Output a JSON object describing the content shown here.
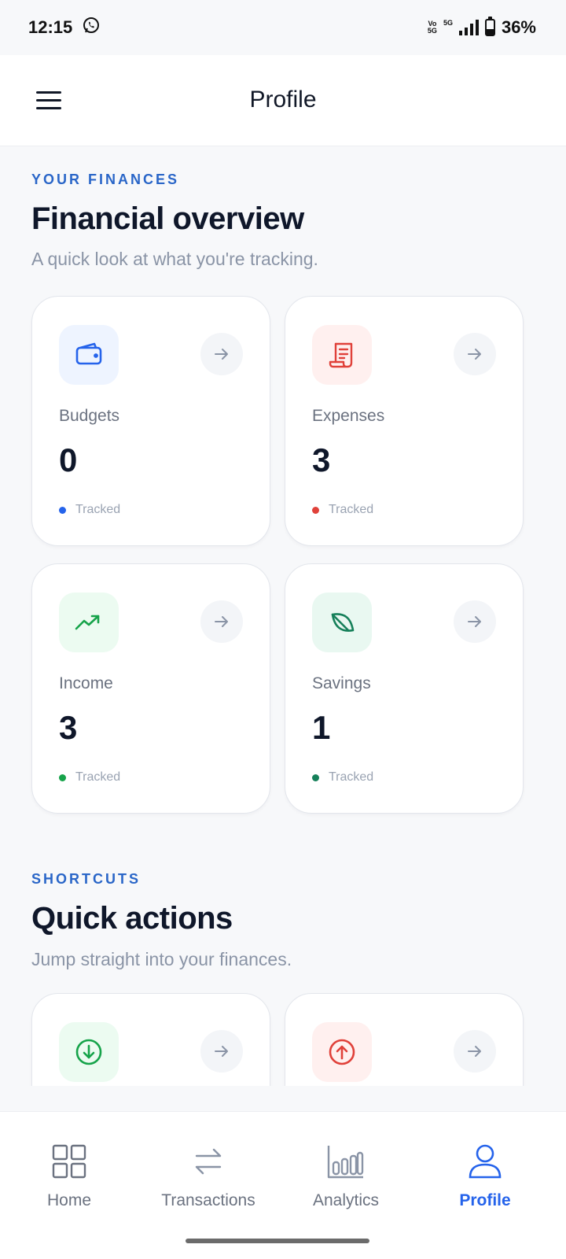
{
  "status_bar": {
    "time": "12:15",
    "whatsapp_icon": "whatsapp-icon",
    "volte_top": "Vo",
    "volte_bottom": "5G",
    "network": "5G",
    "battery": "36%"
  },
  "header": {
    "title": "Profile",
    "menu_icon": "hamburger-menu-icon"
  },
  "finances": {
    "eyebrow": "YOUR FINANCES",
    "title": "Financial overview",
    "subtitle": "A quick look at what you're tracking.",
    "cards": [
      {
        "label": "Budgets",
        "value": "0",
        "status": "Tracked",
        "icon": "wallet-icon",
        "color": "#2563eb",
        "bg": "#eef4ff"
      },
      {
        "label": "Expenses",
        "value": "3",
        "status": "Tracked",
        "icon": "receipt-icon",
        "color": "#e0413a",
        "bg": "#fff0ef"
      },
      {
        "label": "Income",
        "value": "3",
        "status": "Tracked",
        "icon": "trending-up-icon",
        "color": "#16a34a",
        "bg": "#ecfbf1"
      },
      {
        "label": "Savings",
        "value": "1",
        "status": "Tracked",
        "icon": "leaf-icon",
        "color": "#16805a",
        "bg": "#e9f8f1"
      }
    ]
  },
  "shortcuts": {
    "eyebrow": "SHORTCUTS",
    "title": "Quick actions",
    "subtitle": "Jump straight into your finances.",
    "cards": [
      {
        "icon": "arrow-down-circle-icon",
        "color": "#16a34a",
        "bg": "#ecfbf1"
      },
      {
        "icon": "arrow-up-circle-icon",
        "color": "#e0413a",
        "bg": "#fff0ef"
      }
    ]
  },
  "bottom_nav": {
    "items": [
      {
        "label": "Home",
        "icon": "grid-icon",
        "active": false
      },
      {
        "label": "Transactions",
        "icon": "swap-arrows-icon",
        "active": false
      },
      {
        "label": "Analytics",
        "icon": "bar-chart-icon",
        "active": false
      },
      {
        "label": "Profile",
        "icon": "user-icon",
        "active": true
      }
    ],
    "active_color": "#2563eb"
  }
}
